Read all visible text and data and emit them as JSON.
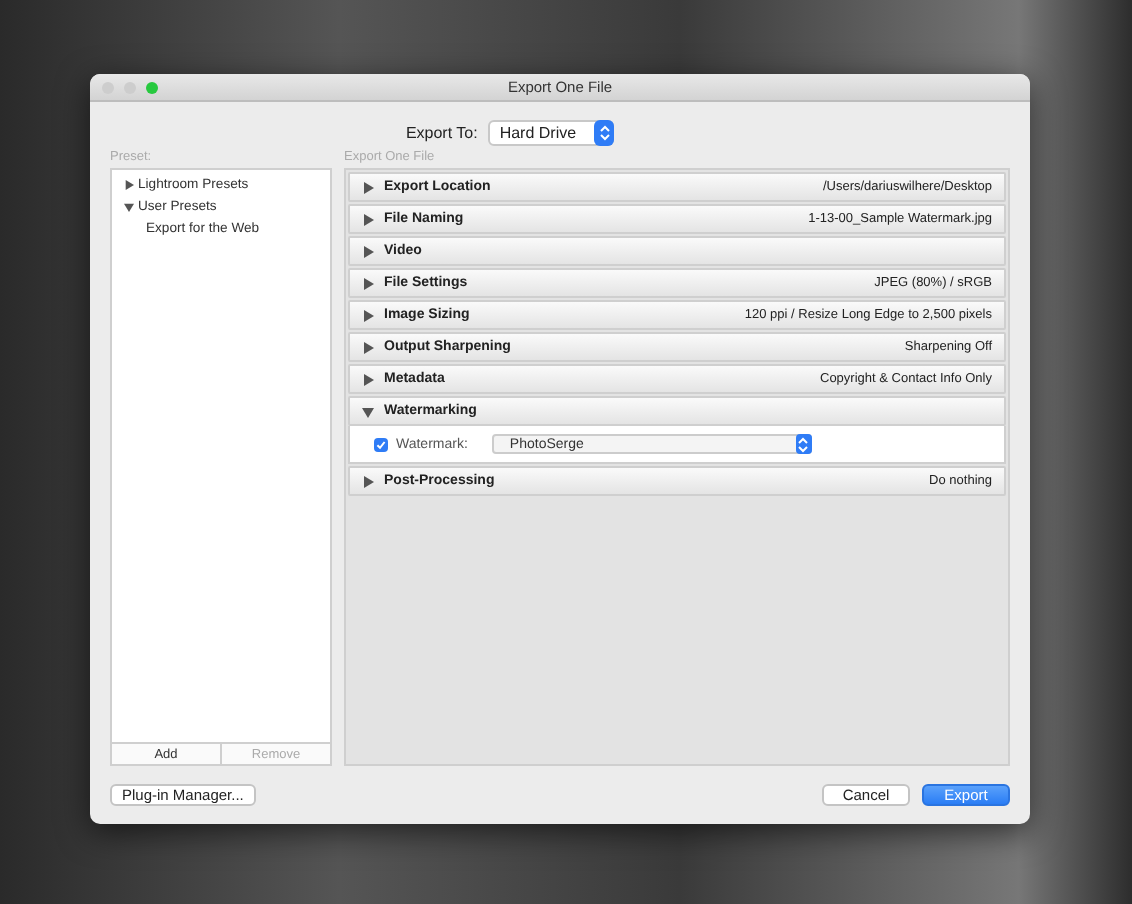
{
  "window": {
    "title": "Export One File"
  },
  "export_to": {
    "label": "Export To:",
    "value": "Hard Drive"
  },
  "preset": {
    "label": "Preset:",
    "items": [
      {
        "label": "Lightroom Presets",
        "expanded": false
      },
      {
        "label": "User Presets",
        "expanded": true,
        "children": [
          {
            "label": "Export for the Web"
          }
        ]
      }
    ],
    "buttons": [
      {
        "label": "Add",
        "disabled": false
      },
      {
        "label": "Remove",
        "disabled": true
      }
    ]
  },
  "panel": {
    "heading": "Export One File",
    "sections": [
      {
        "title": "Export Location",
        "summary": "/Users/dariuswilhere/Desktop",
        "expanded": false
      },
      {
        "title": "File Naming",
        "summary": "1-13-00_Sample Watermark.jpg",
        "expanded": false
      },
      {
        "title": "Video",
        "expanded": false
      },
      {
        "title": "File Settings",
        "summary": "JPEG (80%) / sRGB",
        "expanded": false
      },
      {
        "title": "Image Sizing",
        "summary": "120 ppi / Resize Long Edge to 2,500 pixels",
        "expanded": false
      },
      {
        "title": "Output Sharpening",
        "summary": "Sharpening Off",
        "expanded": false
      },
      {
        "title": "Metadata",
        "summary": "Copyright & Contact Info Only",
        "expanded": false
      },
      {
        "title": "Watermarking",
        "expanded": true,
        "watermark": {
          "label": "Watermark:",
          "checked": true,
          "value": "PhotoSerge"
        }
      },
      {
        "title": "Post-Processing",
        "summary": "Do nothing",
        "expanded": false
      }
    ]
  },
  "footer": [
    {
      "label": "Plug-in Manager...",
      "kind": "left"
    },
    {
      "label": "Cancel",
      "kind": "default"
    },
    {
      "label": "Export",
      "kind": "primary"
    }
  ]
}
